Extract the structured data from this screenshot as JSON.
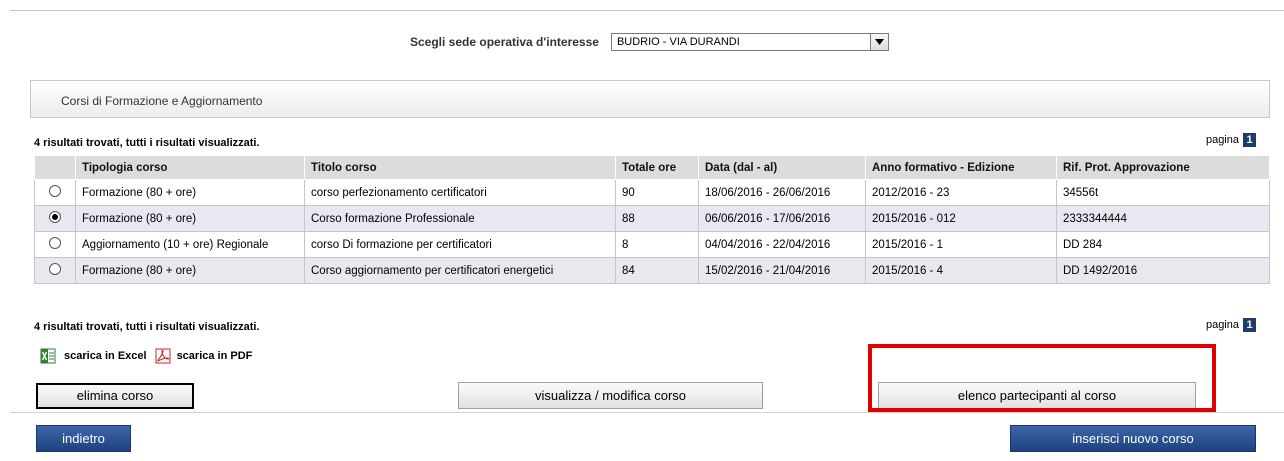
{
  "sede": {
    "label": "Scegli sede operativa d'interesse",
    "selected": "BUDRIO - VIA DURANDI"
  },
  "panel": {
    "title": "Corsi di Formazione e Aggiornamento"
  },
  "results": {
    "info": "4 risultati trovati, tutti i risultati visualizzati.",
    "pagina_label": "pagina",
    "page_number": "1"
  },
  "table": {
    "headers": [
      "",
      "Tipologia corso",
      "Titolo corso",
      "Totale ore",
      "Data (dal - al)",
      "Anno formativo - Edizione",
      "Rif. Prot. Approvazione"
    ],
    "rows": [
      {
        "selected": false,
        "tipologia": "Formazione (80 + ore)",
        "titolo": "corso perfezionamento certificatori",
        "ore": "90",
        "data": "18/06/2016 - 26/06/2016",
        "anno": "2012/2016 - 23",
        "rif": "34556t"
      },
      {
        "selected": true,
        "tipologia": "Formazione (80 + ore)",
        "titolo": "Corso formazione Professionale",
        "ore": "88",
        "data": "06/06/2016 - 17/06/2016",
        "anno": "2015/2016 - 012",
        "rif": "2333344444"
      },
      {
        "selected": false,
        "tipologia": "Aggiornamento (10 + ore) Regionale",
        "titolo": "corso Di formazione per certificatori",
        "ore": "8",
        "data": "04/04/2016 - 22/04/2016",
        "anno": "2015/2016 - 1",
        "rif": "DD 284"
      },
      {
        "selected": false,
        "tipologia": "Formazione (80 + ore)",
        "titolo": "Corso aggiornamento per certificatori energetici",
        "ore": "84",
        "data": "15/02/2016 - 21/04/2016",
        "anno": "2015/2016 - 4",
        "rif": "DD 1492/2016"
      }
    ]
  },
  "downloads": {
    "excel": "scarica in Excel",
    "pdf": "scarica in PDF"
  },
  "buttons": {
    "elimina": "elimina corso",
    "visualizza": "visualizza / modifica corso",
    "elenco": "elenco partecipanti al corso",
    "indietro": "indietro",
    "inserisci": "inserisci nuovo corso"
  },
  "colors": {
    "highlight": "#e00000",
    "blue_button": "#2a5090",
    "page_badge": "#1f3d6b"
  }
}
